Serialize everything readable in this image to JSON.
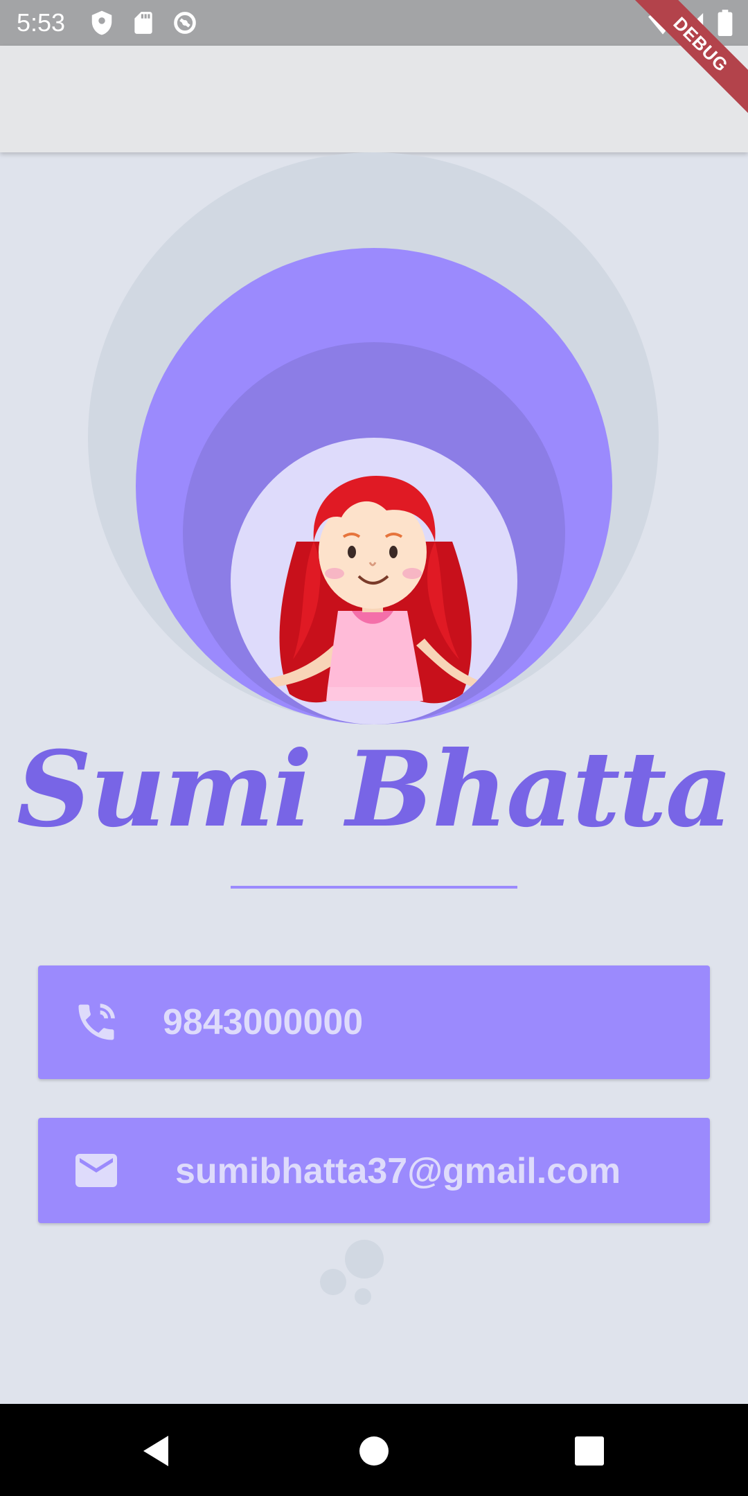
{
  "status_bar": {
    "time": "5:53",
    "left_icons": [
      "shield-icon",
      "sd-card-icon",
      "sync-icon"
    ],
    "right_icons": [
      "wifi-icon",
      "signal-icon",
      "battery-icon"
    ]
  },
  "debug_banner": {
    "label": "DEBUG"
  },
  "profile": {
    "name": "Sumi Bhatta",
    "avatar_icon": "girl-avatar-icon"
  },
  "contacts": {
    "phone": {
      "icon": "phone-icon",
      "value": "9843000000"
    },
    "email": {
      "icon": "mail-icon",
      "value": "sumibhatta37@gmail.com"
    }
  },
  "nav_bar": {
    "buttons": [
      "back-icon",
      "home-icon",
      "recents-icon"
    ]
  },
  "colors": {
    "accent": "#9b8afd",
    "accent_dark": "#8c7de6",
    "name_text": "#7865e6",
    "background": "#dfe3ec",
    "outer_circle": "#d1d8e2",
    "avatar_bg": "#dedbfb"
  }
}
